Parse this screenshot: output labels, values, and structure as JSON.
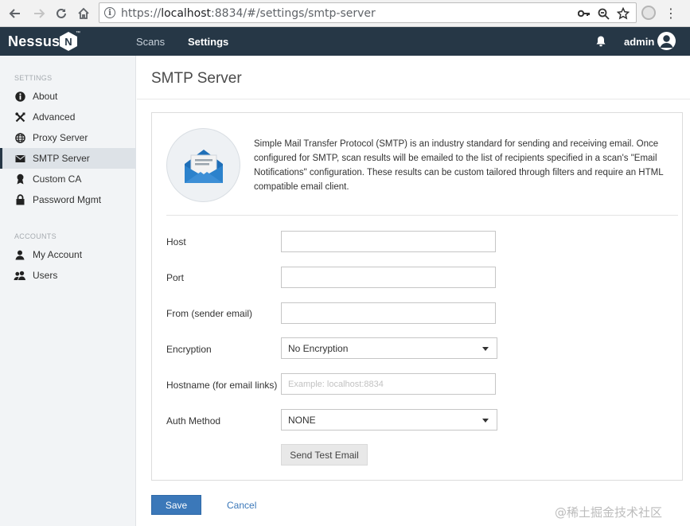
{
  "browser": {
    "url_scheme": "https://",
    "url_host": "localhost",
    "url_rest": ":8834/#/settings/smtp-server"
  },
  "header": {
    "logo_text": "Nessus",
    "logo_badge": "N",
    "logo_tm": "™",
    "nav": [
      {
        "label": "Scans",
        "active": false
      },
      {
        "label": "Settings",
        "active": true
      }
    ],
    "username": "admin",
    "bg_color": "#263746"
  },
  "sidebar": {
    "settings_heading": "SETTINGS",
    "settings_items": [
      {
        "label": "About",
        "icon": "info-icon"
      },
      {
        "label": "Advanced",
        "icon": "tools-icon"
      },
      {
        "label": "Proxy Server",
        "icon": "globe-icon"
      },
      {
        "label": "SMTP Server",
        "icon": "envelope-icon",
        "active": true
      },
      {
        "label": "Custom CA",
        "icon": "certificate-icon"
      },
      {
        "label": "Password Mgmt",
        "icon": "lock-icon"
      }
    ],
    "accounts_heading": "ACCOUNTS",
    "accounts_items": [
      {
        "label": "My Account",
        "icon": "user-icon"
      },
      {
        "label": "Users",
        "icon": "users-icon"
      }
    ]
  },
  "main": {
    "title": "SMTP Server",
    "description": "Simple Mail Transfer Protocol (SMTP) is an industry standard for sending and receiving email. Once configured for SMTP, scan results will be emailed to the list of recipients specified in a scan's \"Email Notifications\" configuration. These results can be custom tailored through filters and require an HTML compatible email client.",
    "form": {
      "host_label": "Host",
      "host_value": "",
      "port_label": "Port",
      "port_value": "",
      "from_label": "From (sender email)",
      "from_value": "",
      "encryption_label": "Encryption",
      "encryption_value": "No Encryption",
      "hostname_label": "Hostname (for email links)",
      "hostname_value": "",
      "hostname_placeholder": "Example: localhost:8834",
      "auth_label": "Auth Method",
      "auth_value": "NONE",
      "test_button": "Send Test Email"
    },
    "save_label": "Save",
    "cancel_label": "Cancel",
    "accent_color": "#3b78b9"
  },
  "watermark": "@稀土掘金技术社区"
}
